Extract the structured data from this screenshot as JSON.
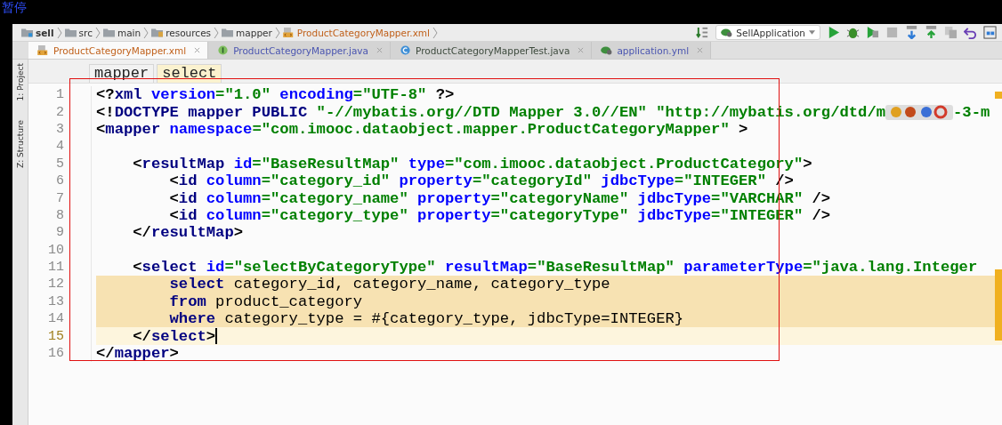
{
  "player": {
    "status": "暂停"
  },
  "breadcrumb": [
    {
      "label": "sell",
      "kind": "module"
    },
    {
      "label": "src",
      "kind": "folder"
    },
    {
      "label": "main",
      "kind": "folder"
    },
    {
      "label": "resources",
      "kind": "resources"
    },
    {
      "label": "mapper",
      "kind": "folder"
    },
    {
      "label": "ProductCategoryMapper.xml",
      "kind": "xml"
    }
  ],
  "run_config": {
    "label": "SellApplication"
  },
  "tool_strip": [
    {
      "label": "1: Project"
    },
    {
      "label": "Z: Structure"
    }
  ],
  "tabs": [
    {
      "label": "ProductCategoryMapper.xml",
      "kind": "xml",
      "selected": true
    },
    {
      "label": "ProductCategoryMapper.java",
      "kind": "interface",
      "selected": false
    },
    {
      "label": "ProductCategoryMapperTest.java",
      "kind": "class",
      "selected": false
    },
    {
      "label": "application.yml",
      "kind": "yml",
      "selected": false
    }
  ],
  "tag_path": [
    {
      "label": "mapper",
      "selected": false
    },
    {
      "label": "select",
      "selected": true
    }
  ],
  "lines": [
    {
      "number": "1",
      "highlighted": false,
      "current": false,
      "cursor": false,
      "tokens": [
        {
          "kind": "punct",
          "text": "<?"
        },
        {
          "kind": "tag",
          "text": "xml"
        },
        {
          "kind": "attr",
          "text": " version"
        },
        {
          "kind": "value",
          "text": "=\"1.0\""
        },
        {
          "kind": "attr",
          "text": " encoding"
        },
        {
          "kind": "value",
          "text": "=\"UTF-8\""
        },
        {
          "kind": "punct",
          "text": " ?>"
        }
      ]
    },
    {
      "number": "2",
      "highlighted": false,
      "current": false,
      "cursor": false,
      "tokens": [
        {
          "kind": "punct",
          "text": "<!"
        },
        {
          "kind": "tag",
          "text": "DOCTYPE mapper PUBLIC"
        },
        {
          "kind": "value",
          "text": " \"-//mybatis.org//DTD Mapper 3.0//EN\""
        },
        {
          "kind": "value",
          "text": " \"http://mybatis.org/dtd/m"
        },
        {
          "kind": "browser-popup"
        },
        {
          "kind": "value",
          "text": "-3-m"
        }
      ]
    },
    {
      "number": "3",
      "highlighted": false,
      "current": false,
      "cursor": false,
      "tokens": [
        {
          "kind": "punct",
          "text": "<"
        },
        {
          "kind": "tag",
          "text": "mapper"
        },
        {
          "kind": "attr",
          "text": " namespace"
        },
        {
          "kind": "value",
          "text": "=\"com.imooc.dataobject.mapper.ProductCategoryMapper\""
        },
        {
          "kind": "punct",
          "text": " >"
        }
      ]
    },
    {
      "number": "4",
      "highlighted": false,
      "current": false,
      "cursor": false
    },
    {
      "number": "5",
      "highlighted": false,
      "current": false,
      "cursor": false,
      "tokens": [
        {
          "kind": "punct",
          "text": "    <"
        },
        {
          "kind": "tag",
          "text": "resultMap"
        },
        {
          "kind": "attr",
          "text": " id"
        },
        {
          "kind": "value",
          "text": "=\"BaseResultMap\""
        },
        {
          "kind": "attr",
          "text": " type"
        },
        {
          "kind": "value",
          "text": "=\"com.imooc.dataobject.ProductCategory\""
        },
        {
          "kind": "punct",
          "text": ">"
        }
      ]
    },
    {
      "number": "6",
      "highlighted": false,
      "current": false,
      "cursor": false,
      "tokens": [
        {
          "kind": "punct",
          "text": "        <"
        },
        {
          "kind": "tag",
          "text": "id"
        },
        {
          "kind": "attr",
          "text": " column"
        },
        {
          "kind": "value",
          "text": "=\"category_id\""
        },
        {
          "kind": "attr",
          "text": " property"
        },
        {
          "kind": "value",
          "text": "=\"categoryId\""
        },
        {
          "kind": "attr",
          "text": " jdbcType"
        },
        {
          "kind": "value",
          "text": "=\"INTEGER\""
        },
        {
          "kind": "punct",
          "text": " />"
        }
      ]
    },
    {
      "number": "7",
      "highlighted": false,
      "current": false,
      "cursor": false,
      "tokens": [
        {
          "kind": "punct",
          "text": "        <"
        },
        {
          "kind": "tag",
          "text": "id"
        },
        {
          "kind": "attr",
          "text": " column"
        },
        {
          "kind": "value",
          "text": "=\"category_name\""
        },
        {
          "kind": "attr",
          "text": " property"
        },
        {
          "kind": "value",
          "text": "=\"categoryName\""
        },
        {
          "kind": "attr",
          "text": " jdbcType"
        },
        {
          "kind": "value",
          "text": "=\"VARCHAR\""
        },
        {
          "kind": "punct",
          "text": " />"
        }
      ]
    },
    {
      "number": "8",
      "highlighted": false,
      "current": false,
      "cursor": false,
      "tokens": [
        {
          "kind": "punct",
          "text": "        <"
        },
        {
          "kind": "tag",
          "text": "id"
        },
        {
          "kind": "attr",
          "text": " column"
        },
        {
          "kind": "value",
          "text": "=\"category_type\""
        },
        {
          "kind": "attr",
          "text": " property"
        },
        {
          "kind": "value",
          "text": "=\"categoryType\""
        },
        {
          "kind": "attr",
          "text": " jdbcType"
        },
        {
          "kind": "value",
          "text": "=\"INTEGER\""
        },
        {
          "kind": "punct",
          "text": " />"
        }
      ]
    },
    {
      "number": "9",
      "highlighted": false,
      "current": false,
      "cursor": false,
      "tokens": [
        {
          "kind": "punct",
          "text": "    </"
        },
        {
          "kind": "tag",
          "text": "resultMap"
        },
        {
          "kind": "punct",
          "text": ">"
        }
      ]
    },
    {
      "number": "10",
      "highlighted": false,
      "current": false,
      "cursor": false
    },
    {
      "number": "11",
      "highlighted": false,
      "current": false,
      "cursor": false,
      "tokens": [
        {
          "kind": "punct",
          "text": "    <"
        },
        {
          "kind": "tag",
          "text": "select"
        },
        {
          "kind": "attr",
          "text": " id"
        },
        {
          "kind": "value",
          "text": "=\"selectByCategoryType\""
        },
        {
          "kind": "attr",
          "text": " resultMap"
        },
        {
          "kind": "value",
          "text": "=\"BaseResultMap\""
        },
        {
          "kind": "attr",
          "text": " parameterType"
        },
        {
          "kind": "value",
          "text": "=\"java.lang.Integer"
        }
      ]
    },
    {
      "number": "12",
      "highlighted": true,
      "current": false,
      "cursor": false,
      "tokens": [
        {
          "kind": "keyword",
          "text": "        select"
        },
        {
          "kind": "text",
          "text": " category_id, category_name, category_type"
        }
      ]
    },
    {
      "number": "13",
      "highlighted": true,
      "current": false,
      "cursor": false,
      "tokens": [
        {
          "kind": "keyword",
          "text": "        from"
        },
        {
          "kind": "text",
          "text": " product_category"
        }
      ]
    },
    {
      "number": "14",
      "highlighted": true,
      "current": false,
      "cursor": false,
      "tokens": [
        {
          "kind": "keyword",
          "text": "        where"
        },
        {
          "kind": "text",
          "text": " category_type = #{category_type, jdbcType=INTEGER}"
        }
      ]
    },
    {
      "number": "15",
      "highlighted": false,
      "current": true,
      "cursor": true,
      "tokens": [
        {
          "kind": "punct",
          "text": "    </"
        },
        {
          "kind": "tag",
          "text": "select"
        },
        {
          "kind": "punct",
          "text": ">"
        }
      ]
    },
    {
      "number": "16",
      "highlighted": false,
      "current": false,
      "cursor": false,
      "tokens": [
        {
          "kind": "punct",
          "text": "</"
        },
        {
          "kind": "tag",
          "text": "mapper"
        },
        {
          "kind": "punct",
          "text": ">"
        }
      ]
    }
  ]
}
